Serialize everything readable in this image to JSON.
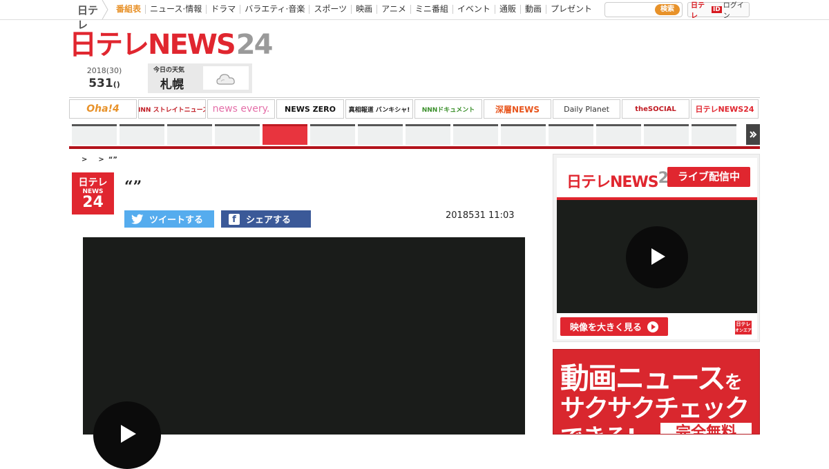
{
  "gnav": {
    "logo": "日テレ",
    "items": [
      "番組表",
      "ニュース·情報",
      "ドラマ",
      "バラエティ·音楽",
      "スポーツ",
      "映画",
      "アニメ",
      "ミニ番組",
      "イベント",
      "通販",
      "動画",
      "プレゼント"
    ],
    "search_placeholder": "",
    "search_button": "検索",
    "login_ntv": "日テレ",
    "login_id": "ID",
    "login_label": "ログイン"
  },
  "brand": {
    "main": "日テレNEWS",
    "num": "24"
  },
  "date": {
    "line1": "2018(30)",
    "line2": "531",
    "line2_suffix": "()"
  },
  "weather": {
    "label": "今日の天気",
    "city": "札幌",
    "icon": "cloud-icon"
  },
  "programs": [
    "Oha!4",
    "NNN ストレイトニュース",
    "news every.",
    "NEWS ZERO",
    "真相報道 バンキシャ!",
    "NNNドキュメント",
    "深層NEWS",
    "Daily Planet",
    "theSOCIAL",
    "日テレNEWS24"
  ],
  "breadcrumb": [
    ">",
    ">",
    "“”"
  ],
  "article": {
    "logo_top": "日テレ",
    "logo_mid": "NEWS",
    "logo_num": "24",
    "title": "“”",
    "tweet_label": "ツイートする",
    "share_label": "シェアする",
    "datetime": "2018531 11:03"
  },
  "live": {
    "brand_main": "日テレNEWS",
    "brand_num": "24",
    "badge": "ライブ配信中",
    "big_button": "映像を大きく見る",
    "mini_logo_top": "日テレ",
    "mini_logo_bottom": "オンエア"
  },
  "promo": {
    "line1": "動画ニュース",
    "line1_suffix": "を",
    "line2": "サクサクチェック",
    "line2_suffix": "",
    "line3": "できる!",
    "free": "完全無料"
  },
  "colors": {
    "brand_red": "#e0262f",
    "accent_orange": "#e8922a",
    "twitter": "#55acee",
    "facebook": "#3b5998"
  }
}
